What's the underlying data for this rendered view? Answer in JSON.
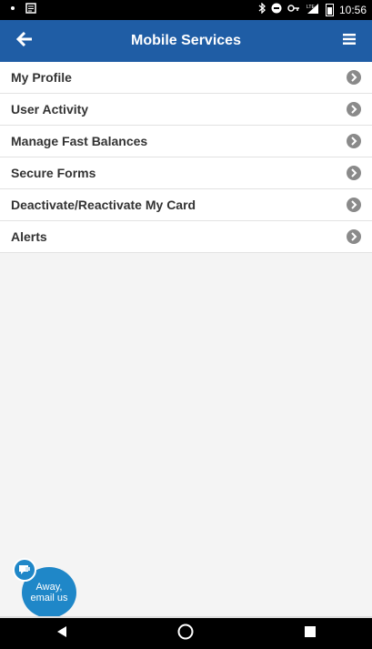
{
  "status_bar": {
    "time": "10:56",
    "left_icons": [
      "notification-dot-icon",
      "news-icon"
    ],
    "right_icons": [
      "bluetooth-icon",
      "do-not-disturb-icon",
      "vpn-key-icon",
      "signal-lte-icon",
      "battery-icon"
    ],
    "network_label": "LTE"
  },
  "header": {
    "title": "Mobile Services",
    "back_icon": "arrow-left-icon",
    "menu_icon": "hamburger-icon",
    "color": "#1f5da5"
  },
  "menu": {
    "items": [
      {
        "label": "My Profile"
      },
      {
        "label": "User Activity"
      },
      {
        "label": "Manage Fast Balances"
      },
      {
        "label": "Secure Forms"
      },
      {
        "label": "Deactivate/Reactivate My Card"
      },
      {
        "label": "Alerts"
      }
    ],
    "chevron_icon": "chevron-right-circle-icon"
  },
  "chat": {
    "line1": "Away,",
    "line2": "email us",
    "icon": "chat-bubble-icon",
    "color": "#1f87c8"
  },
  "nav_bar": {
    "back": "back-triangle-icon",
    "home": "home-circle-icon",
    "recents": "recents-square-icon"
  }
}
